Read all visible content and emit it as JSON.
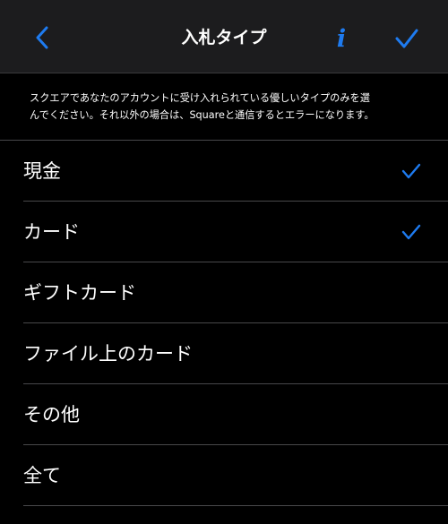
{
  "nav": {
    "title": "入札タイプ",
    "back_icon": "chevron-left-icon",
    "info_label": "i",
    "done_icon": "checkmark-icon"
  },
  "description": {
    "line1": "スクエアであなたのアカウントに受け入れられている優しいタイプのみを選",
    "line2": "んでください。それ以外の場合は、Squareと通信するとエラーになります。"
  },
  "tender_types": [
    {
      "label": "現金",
      "checked": true
    },
    {
      "label": "カード",
      "checked": true
    },
    {
      "label": "ギフトカード",
      "checked": false
    },
    {
      "label": "ファイル上のカード",
      "checked": false
    },
    {
      "label": "その他",
      "checked": false
    },
    {
      "label": "全て",
      "checked": false
    }
  ],
  "colors": {
    "accent": "#1e7bf0",
    "background": "#000000",
    "navbar": "#1c1c1e",
    "separator": "#48484a"
  }
}
